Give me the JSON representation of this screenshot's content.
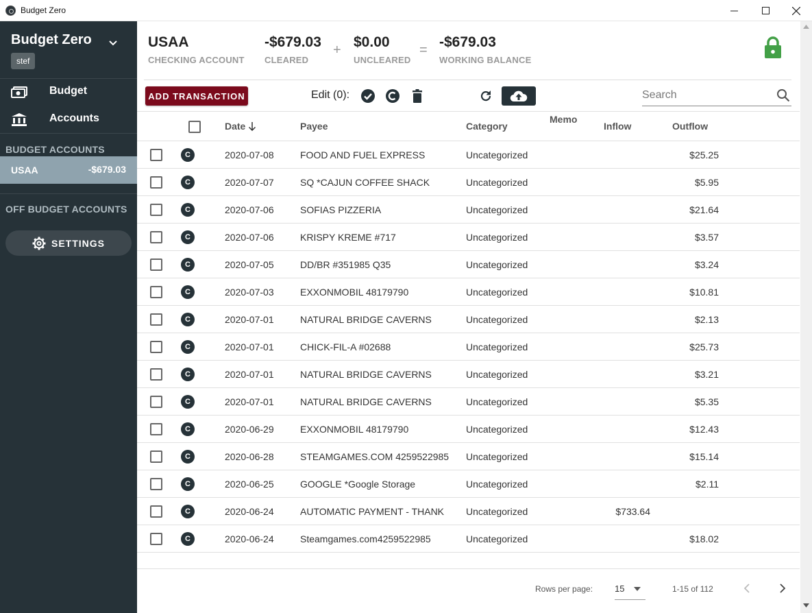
{
  "window": {
    "title": "Budget Zero",
    "min_glyph": "—",
    "max_glyph": "☐",
    "close_glyph": "✕"
  },
  "sidebar": {
    "budget_name": "Budget Zero",
    "user": "stef",
    "nav": [
      {
        "label": "Budget",
        "icon": "money-icon"
      },
      {
        "label": "Accounts",
        "icon": "bank-icon"
      }
    ],
    "budget_accounts_heading": "BUDGET ACCOUNTS",
    "accounts": [
      {
        "name": "USAA",
        "balance": "-$679.03"
      }
    ],
    "off_budget_heading": "OFF BUDGET ACCOUNTS",
    "settings_label": "SETTINGS"
  },
  "header": {
    "account_name": "USAA",
    "account_type": "CHECKING ACCOUNT",
    "cleared_value": "-$679.03",
    "cleared_label": "CLEARED",
    "plus": "+",
    "uncleared_value": "$0.00",
    "uncleared_label": "UNCLEARED",
    "equals": "=",
    "working_value": "-$679.03",
    "working_label": "WORKING BALANCE",
    "lock_color": "#43a047"
  },
  "toolbar": {
    "add_label": "ADD TRANSACTION",
    "edit_label": "Edit (0):",
    "search_placeholder": "Search"
  },
  "table": {
    "columns": {
      "date": "Date",
      "payee": "Payee",
      "category": "Category",
      "memo": "Memo",
      "inflow": "Inflow",
      "outflow": "Outflow"
    },
    "rows": [
      {
        "status": "C",
        "date": "2020-07-08",
        "payee": "FOOD AND FUEL EXPRESS",
        "category": "Uncategorized",
        "memo": "",
        "inflow": "",
        "outflow": "$25.25"
      },
      {
        "status": "C",
        "date": "2020-07-07",
        "payee": "SQ *CAJUN COFFEE SHACK",
        "category": "Uncategorized",
        "memo": "",
        "inflow": "",
        "outflow": "$5.95"
      },
      {
        "status": "C",
        "date": "2020-07-06",
        "payee": "SOFIAS PIZZERIA",
        "category": "Uncategorized",
        "memo": "",
        "inflow": "",
        "outflow": "$21.64"
      },
      {
        "status": "C",
        "date": "2020-07-06",
        "payee": "KRISPY KREME #717",
        "category": "Uncategorized",
        "memo": "",
        "inflow": "",
        "outflow": "$3.57"
      },
      {
        "status": "C",
        "date": "2020-07-05",
        "payee": "DD/BR #351985 Q35",
        "category": "Uncategorized",
        "memo": "",
        "inflow": "",
        "outflow": "$3.24"
      },
      {
        "status": "C",
        "date": "2020-07-03",
        "payee": "EXXONMOBIL 48179790",
        "category": "Uncategorized",
        "memo": "",
        "inflow": "",
        "outflow": "$10.81"
      },
      {
        "status": "C",
        "date": "2020-07-01",
        "payee": "NATURAL BRIDGE CAVERNS",
        "category": "Uncategorized",
        "memo": "",
        "inflow": "",
        "outflow": "$2.13"
      },
      {
        "status": "C",
        "date": "2020-07-01",
        "payee": "CHICK-FIL-A #02688",
        "category": "Uncategorized",
        "memo": "",
        "inflow": "",
        "outflow": "$25.73"
      },
      {
        "status": "C",
        "date": "2020-07-01",
        "payee": "NATURAL BRIDGE CAVERNS",
        "category": "Uncategorized",
        "memo": "",
        "inflow": "",
        "outflow": "$3.21"
      },
      {
        "status": "C",
        "date": "2020-07-01",
        "payee": "NATURAL BRIDGE CAVERNS",
        "category": "Uncategorized",
        "memo": "",
        "inflow": "",
        "outflow": "$5.35"
      },
      {
        "status": "C",
        "date": "2020-06-29",
        "payee": "EXXONMOBIL 48179790",
        "category": "Uncategorized",
        "memo": "",
        "inflow": "",
        "outflow": "$12.43"
      },
      {
        "status": "C",
        "date": "2020-06-28",
        "payee": "STEAMGAMES.COM 4259522985",
        "category": "Uncategorized",
        "memo": "",
        "inflow": "",
        "outflow": "$15.14"
      },
      {
        "status": "C",
        "date": "2020-06-25",
        "payee": "GOOGLE *Google Storage",
        "category": "Uncategorized",
        "memo": "",
        "inflow": "",
        "outflow": "$2.11"
      },
      {
        "status": "C",
        "date": "2020-06-24",
        "payee": "AUTOMATIC PAYMENT - THANK",
        "category": "Uncategorized",
        "memo": "",
        "inflow": "$733.64",
        "outflow": ""
      },
      {
        "status": "C",
        "date": "2020-06-24",
        "payee": "Steamgames.com4259522985",
        "category": "Uncategorized",
        "memo": "",
        "inflow": "",
        "outflow": "$18.02"
      }
    ]
  },
  "pagination": {
    "rows_per_page_label": "Rows per page:",
    "rows_per_page": "15",
    "range": "1-15 of 112"
  },
  "colors": {
    "sidebar_bg": "#263238",
    "selected_account_bg": "#8fa3ae",
    "add_button_bg": "#7b0a1c",
    "lock_green": "#43a047"
  }
}
